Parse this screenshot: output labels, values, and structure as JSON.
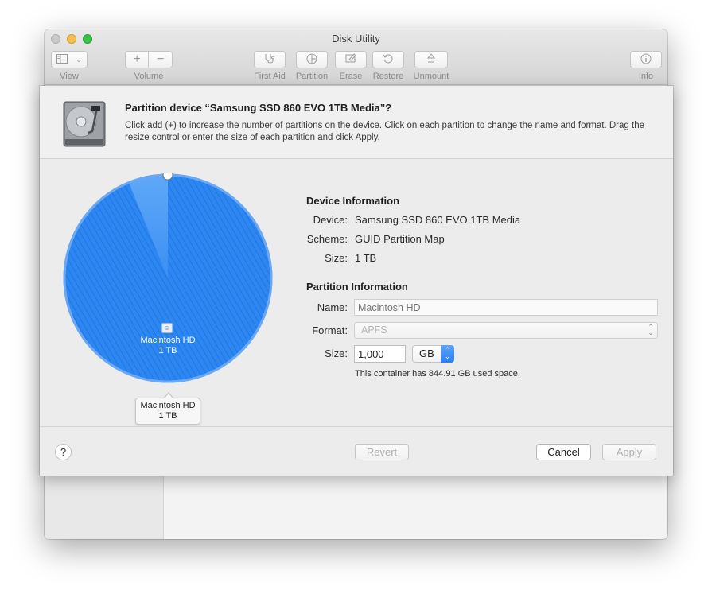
{
  "window": {
    "title": "Disk Utility"
  },
  "toolbar": {
    "view_label": "View",
    "volume_label": "Volume",
    "volume_add": "+",
    "volume_remove": "−",
    "first_aid_label": "First Aid",
    "partition_label": "Partition",
    "erase_label": "Erase",
    "restore_label": "Restore",
    "unmount_label": "Unmount",
    "info_label": "Info"
  },
  "sheet": {
    "title": "Partition device “Samsung SSD 860 EVO 1TB Media”?",
    "description": "Click add (+) to increase the number of partitions on the device. Click on each partition to change the name and format. Drag the resize control or enter the size of each partition and click Apply."
  },
  "pie": {
    "partition_name": "Macintosh HD",
    "partition_size": "1 TB",
    "tooltip_name": "Macintosh HD",
    "tooltip_size": "1 TB",
    "color": "#2d87f3"
  },
  "device_info": {
    "heading": "Device Information",
    "device_label": "Device:",
    "device_value": "Samsung SSD 860 EVO 1TB Media",
    "scheme_label": "Scheme:",
    "scheme_value": "GUID Partition Map",
    "size_label": "Size:",
    "size_value": "1 TB"
  },
  "partition_info": {
    "heading": "Partition Information",
    "name_label": "Name:",
    "name_placeholder": "Macintosh HD",
    "format_label": "Format:",
    "format_value": "APFS",
    "size_label": "Size:",
    "size_value": "1,000",
    "size_unit": "GB",
    "note": "This container has 844.91 GB used space."
  },
  "footer": {
    "help": "?",
    "revert": "Revert",
    "cancel": "Cancel",
    "apply": "Apply"
  }
}
